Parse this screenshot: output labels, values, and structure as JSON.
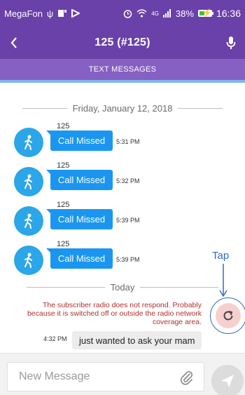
{
  "status_bar": {
    "carrier": "MegaFon",
    "network": "4G",
    "battery": "38%",
    "battery_level": 0.38,
    "time": "16:36"
  },
  "header": {
    "title": "125 (#125)",
    "back_icon": "chevron-left-icon",
    "mic_icon": "microphone-icon"
  },
  "tabs": {
    "active_label": "TEXT MESSAGES"
  },
  "chat": {
    "date_separator": "Friday, January 12, 2018",
    "today_separator": "Today",
    "incoming": [
      {
        "sender": "125",
        "text": "Call Missed",
        "time": "5:31 PM"
      },
      {
        "sender": "125",
        "text": "Call Missed",
        "time": "5:32 PM"
      },
      {
        "sender": "125",
        "text": "Call Missed",
        "time": "5:39 PM"
      },
      {
        "sender": "125",
        "text": "Call Missed",
        "time": "5:39 PM"
      }
    ],
    "error_message": "The subscriber radio does not respond. Probably because it is switched off or outside the radio network coverage area.",
    "outgoing": {
      "time": "4:32 PM",
      "text": "just wanted to ask your mam"
    },
    "annotation": "Tap"
  },
  "composer": {
    "placeholder": "New Message",
    "attach_icon": "paperclip-icon",
    "send_icon": "send-icon"
  },
  "colors": {
    "header": "#6a41a8",
    "tab_bar": "#8660c2",
    "bubble": "#1a96f0",
    "avatar": "#2ba6e8",
    "error": "#b03030",
    "annotation": "#2b6cc4"
  }
}
